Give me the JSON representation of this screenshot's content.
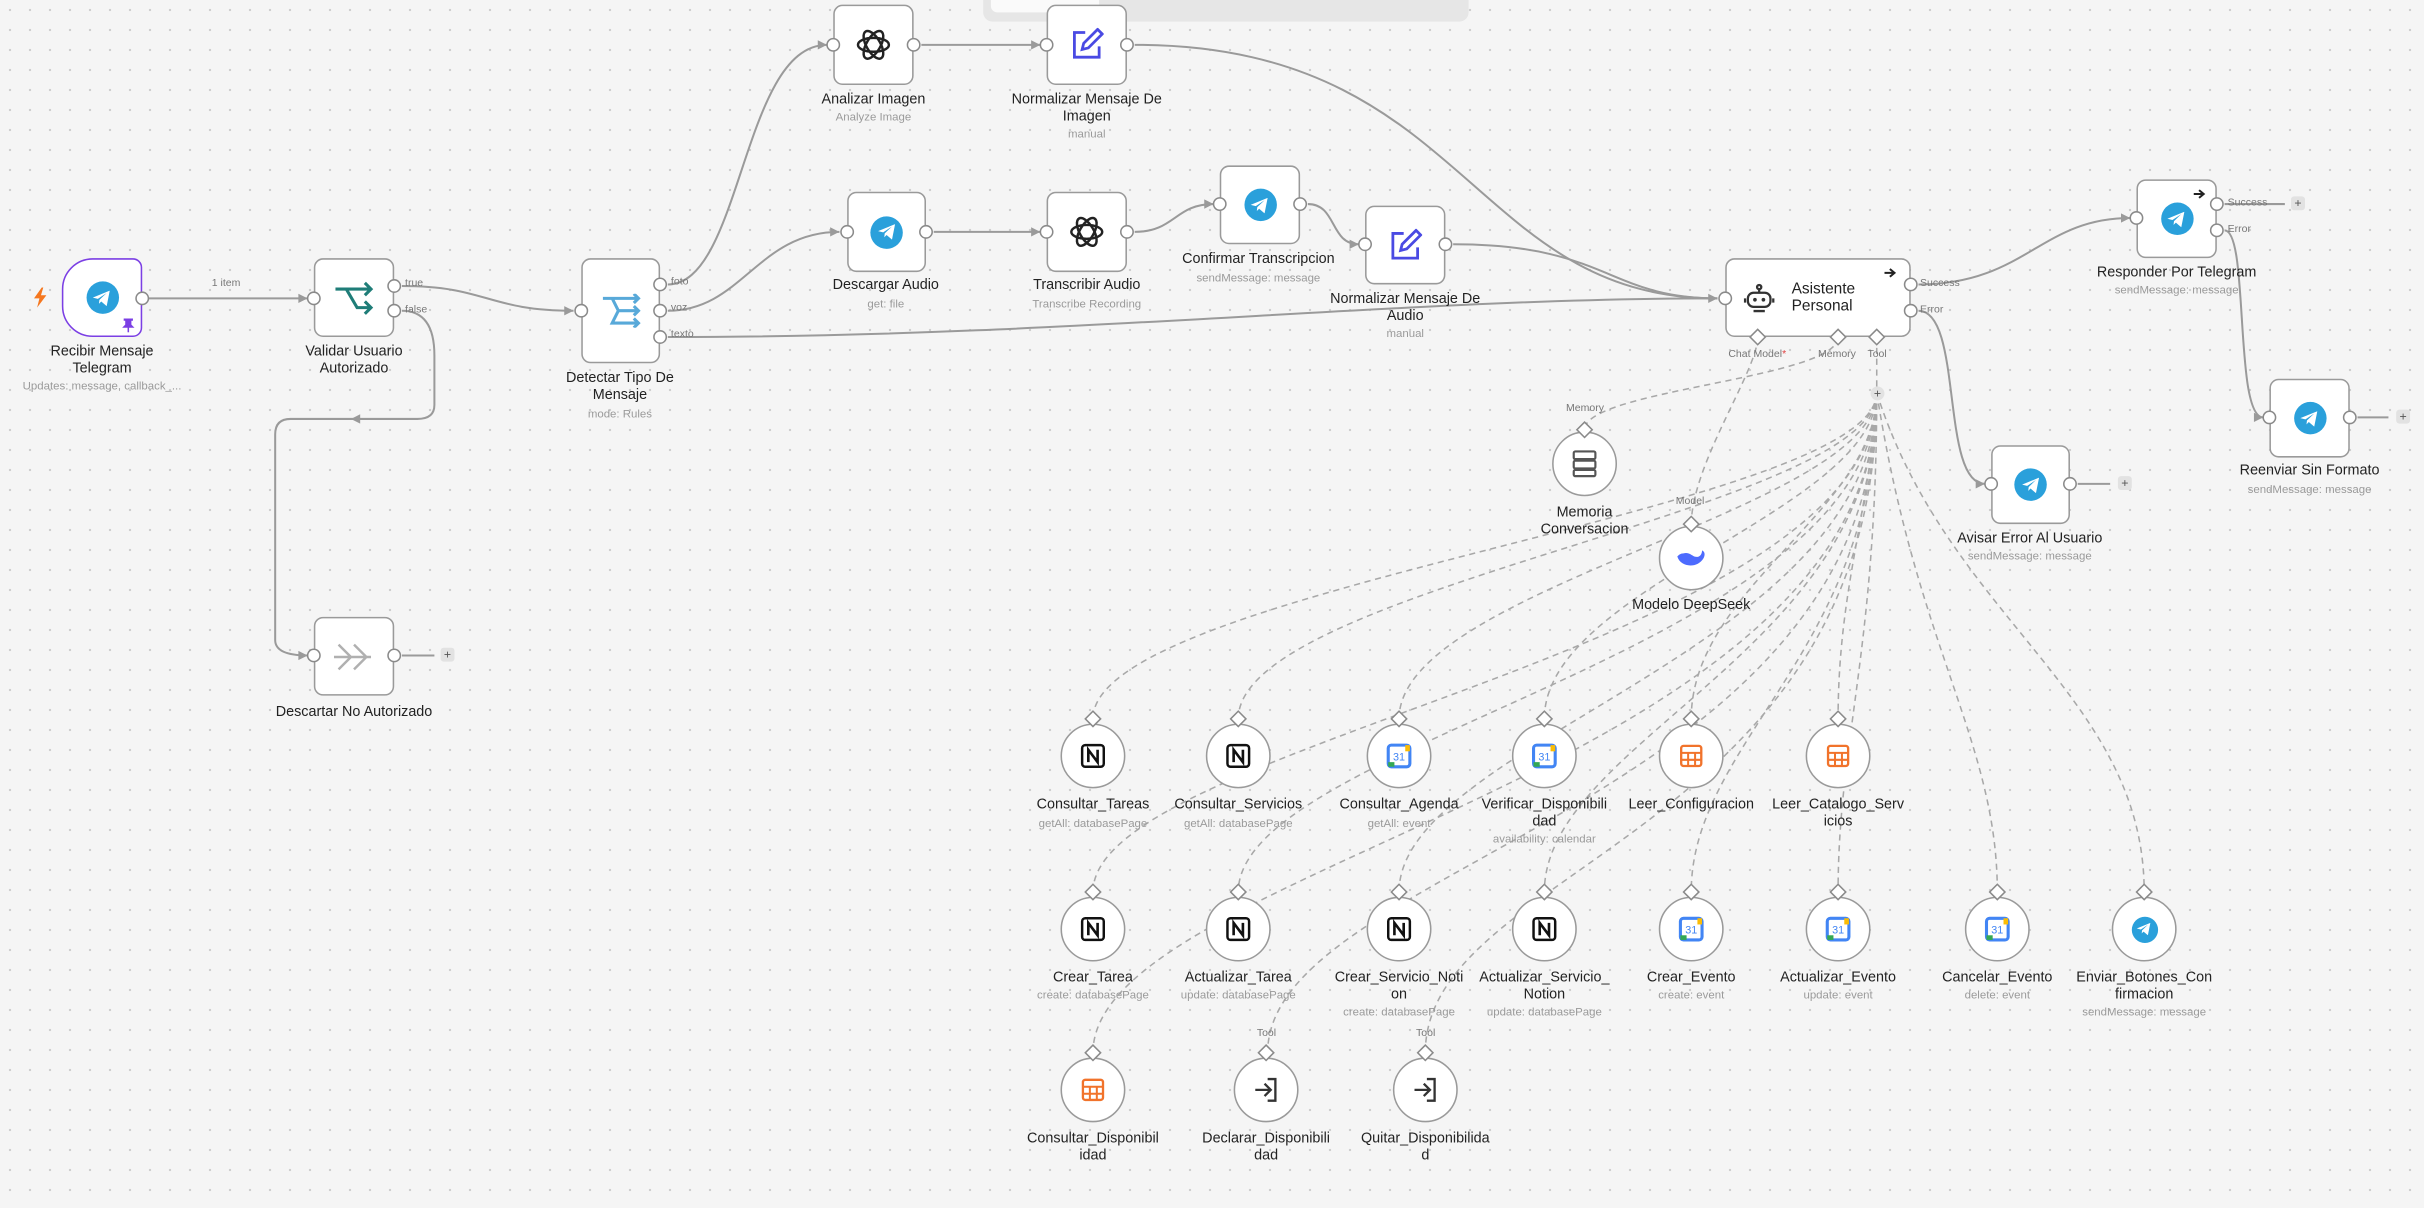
{
  "nodes": {
    "recibir": {
      "title": "Recibir Mensaje Telegram",
      "subtitle": "Updates: message, callback_..."
    },
    "validar": {
      "title": "Validar Usuario Autorizado"
    },
    "descartar": {
      "title": "Descartar No Autorizado"
    },
    "detectar": {
      "title": "Detectar Tipo De Mensaje",
      "subtitle": "mode: Rules"
    },
    "analizar": {
      "title": "Analizar Imagen",
      "subtitle": "Analyze Image"
    },
    "normImagen": {
      "title": "Normalizar Mensaje De Imagen",
      "subtitle": "manual"
    },
    "descargarAudio": {
      "title": "Descargar Audio",
      "subtitle": "get: file"
    },
    "transcribir": {
      "title": "Transcribir Audio",
      "subtitle": "Transcribe Recording"
    },
    "confirmar": {
      "title": "Confirmar Transcripcion",
      "subtitle": "sendMessage: message"
    },
    "normAudio": {
      "title": "Normalizar Mensaje De Audio",
      "subtitle": "manual"
    },
    "asistente": {
      "title": "Asistente Personal"
    },
    "memoria": {
      "title": "Memoria Conversacion"
    },
    "modelo": {
      "title": "Modelo DeepSeek"
    },
    "responder": {
      "title": "Responder Por Telegram",
      "subtitle": "sendMessage: message"
    },
    "reenviar": {
      "title": "Reenviar Sin Formato",
      "subtitle": "sendMessage: message"
    },
    "avisar": {
      "title": "Avisar Error Al Usuario",
      "subtitle": "sendMessage: message"
    },
    "consultarTareas": {
      "title": "Consultar_Tareas",
      "subtitle": "getAll: databasePage"
    },
    "consultarServicios": {
      "title": "Consultar_Servicios",
      "subtitle": "getAll: databasePage"
    },
    "consultarAgenda": {
      "title": "Consultar_Agenda",
      "subtitle": "getAll: event"
    },
    "verificar": {
      "title": "Verificar_Disponibilidad",
      "subtitle": "availability: calendar"
    },
    "leerConfig": {
      "title": "Leer_Configuracion"
    },
    "leerCatalogo": {
      "title": "Leer_Catalogo_Servicios"
    },
    "crearTarea": {
      "title": "Crear_Tarea",
      "subtitle": "create: databasePage"
    },
    "actualizarTarea": {
      "title": "Actualizar_Tarea",
      "subtitle": "update: databasePage"
    },
    "crearServicio": {
      "title": "Crear_Servicio_Notion",
      "subtitle": "create: databasePage"
    },
    "actualizarServicio": {
      "title": "Actualizar_Servicio_Notion",
      "subtitle": "update: databasePage"
    },
    "crearEvento": {
      "title": "Crear_Evento",
      "subtitle": "create: event"
    },
    "actualizarEvento": {
      "title": "Actualizar_Evento",
      "subtitle": "update: event"
    },
    "cancelarEvento": {
      "title": "Cancelar_Evento",
      "subtitle": "delete: event"
    },
    "enviarBotones": {
      "title": "Enviar_Botones_Confirmacion",
      "subtitle": "sendMessage: message"
    },
    "consultarDisp": {
      "title": "Consultar_Disponibilidad"
    },
    "declararDisp": {
      "title": "Declarar_Disponibilidad"
    },
    "quitarDisp": {
      "title": "Quitar_Disponibilidad"
    }
  },
  "ports": {
    "true": "true",
    "false": "false",
    "foto": "foto",
    "voz": "voz",
    "texto": "texto",
    "success": "Success",
    "error": "Error",
    "chat_model": "Chat Model",
    "required_mark": "*",
    "memory": "Memory",
    "tool": "Tool",
    "memory_in": "Memory",
    "model_in": "Model",
    "tool_in": "Tool"
  },
  "edge_labels": {
    "one_item": "1 item"
  },
  "add_symbol": "+",
  "colors": {
    "trigger_border": "#7b3fe4",
    "trigger_bolt": "#f5771f",
    "telegram": "#2aa0db",
    "sheets": "#f1732b",
    "pin": "#7b3fe4"
  },
  "icons": {
    "telegram": "telegram-icon",
    "openai": "openai-icon",
    "notion": "notion-icon",
    "google_calendar": "google-calendar-icon",
    "google_sheets": "google-sheets-icon",
    "switch": "switch-icon",
    "if": "if-icon",
    "noop": "noop-icon",
    "edit": "edit-icon",
    "robot": "robot-icon",
    "memory": "memory-icon",
    "deepseek": "deepseek-icon",
    "workflow_input": "workflow-input-icon"
  }
}
